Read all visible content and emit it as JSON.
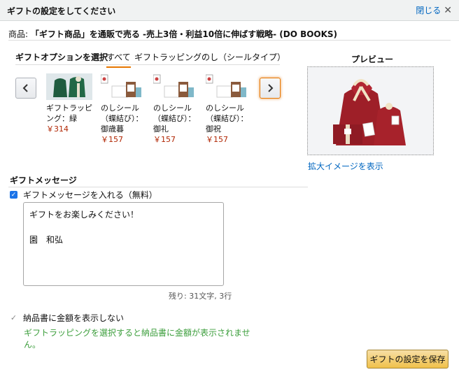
{
  "header": {
    "title": "ギフトの設定をしてください",
    "close_label": "閉じる",
    "close_icon": "close-icon"
  },
  "product": {
    "label": "商品:",
    "name": "「ギフト商品」を通販で売る -売上3倍・利益10倍に伸ばす戦略- (DO BOOKS)"
  },
  "options": {
    "label": "ギフトオプションを選択",
    "tabs": [
      "すべて",
      "ギフトラッピング",
      "のし（シールタイプ）"
    ],
    "active_tab": "すべて"
  },
  "items": [
    {
      "name": "ギフトラッピング：緑",
      "price": "￥314"
    },
    {
      "name": "のしシール（蝶結び）：御歳暮",
      "price": "￥157"
    },
    {
      "name": "のしシール（蝶結び）：御礼",
      "price": "￥157"
    },
    {
      "name": "のしシール（蝶結び）：御祝",
      "price": "￥157"
    }
  ],
  "preview": {
    "title": "プレビュー",
    "enlarge_label": "拡大イメージを表示"
  },
  "message": {
    "section_title": "ギフトメッセージ",
    "include_label": "ギフトメッセージを入れる（無料）",
    "include_checked": true,
    "text": "ギフトをお楽しみください！\n\n園　和弘",
    "remaining": "残り: 31文字, 3行"
  },
  "invoice": {
    "hide_price_label": "納品書に金額を表示しない",
    "note": "ギフトラッピングを選択すると納品書に金額が表示されません。"
  },
  "save_label": "ギフトの設定を保存",
  "colors": {
    "accent": "#e77600",
    "link": "#0066c0",
    "price": "#b12704",
    "note": "#3c9e3c",
    "button": "#f0c14b"
  }
}
